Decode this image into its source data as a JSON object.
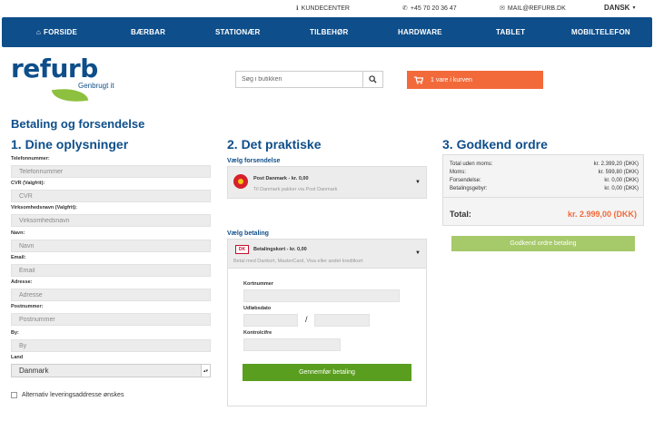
{
  "topbar": {
    "kundecenter": "KUNDECENTER",
    "phone": "+45 70 20 36 47",
    "email": "MAIL@REFURB.DK",
    "language": "DANSK"
  },
  "nav": {
    "items": [
      "FORSIDE",
      "BÆRBAR",
      "STATIONÆR",
      "TILBEHØR",
      "HARDWARE",
      "TABLET",
      "MOBILTELEFON"
    ]
  },
  "logo": {
    "wordmark": "refurb",
    "tagline": "Genbrugt it"
  },
  "search": {
    "placeholder": "Søg i butikken"
  },
  "cart": {
    "label": "1 vare i kurven"
  },
  "page_title": "Betaling og forsendelse",
  "col1": {
    "heading": "1. Dine oplysninger",
    "fields": [
      {
        "label": "Telefonnummer:",
        "placeholder": "Telefonnummer"
      },
      {
        "label": "CVR (Valgfrit):",
        "placeholder": "CVR"
      },
      {
        "label": "Virksomhedsnavn (Valgfrit):",
        "placeholder": "Virksomhedsnavn"
      },
      {
        "label": "Navn:",
        "placeholder": "Navn"
      },
      {
        "label": "Email:",
        "placeholder": "Email"
      },
      {
        "label": "Adresse:",
        "placeholder": "Adresse"
      },
      {
        "label": "Postnummer:",
        "placeholder": "Postnummer"
      },
      {
        "label": "By:",
        "placeholder": "By"
      }
    ],
    "country_label": "Land",
    "country_value": "Danmark",
    "alt_address": "Alternativ leveringsaddresse ønskes"
  },
  "col2": {
    "heading": "2. Det praktiske",
    "shipping_label": "Vælg forsendelse",
    "shipping_title": "Post Danmark - kr. 0,00",
    "shipping_desc": "Til Danmark pakker via Post Danmark",
    "payment_label": "Vælg betaling",
    "payment_title": "Betalingskort - kr. 0,00",
    "payment_desc": "Betal med Dankort, MasterCard, Visa eller andet kreditkort",
    "payment_logo": "DK",
    "card_number_label": "Kortnummer",
    "expiry_label": "Udløbsdato",
    "cvc_label": "Kontrolcifre",
    "slash": "/",
    "pay_button": "Gennemfør betaling"
  },
  "col3": {
    "heading": "3. Godkend ordre",
    "rows": [
      {
        "k": "Total uden moms:",
        "v": "kr. 2.399,20 (DKK)"
      },
      {
        "k": "Moms:",
        "v": "kr. 599,80 (DKK)"
      },
      {
        "k": "Forsendelse:",
        "v": "kr. 0,00 (DKK)"
      },
      {
        "k": "Betalingsgebyr:",
        "v": "kr. 0,00 (DKK)"
      }
    ],
    "total_label": "Total:",
    "total_value": "kr. 2.999,00 (DKK)",
    "approve_button": "Godkend ordre betaling"
  },
  "colors": {
    "brand_blue": "#0e4e8a",
    "accent_orange": "#f26a3a",
    "green": "#5a9e1f",
    "light_green": "#a6c96a"
  }
}
